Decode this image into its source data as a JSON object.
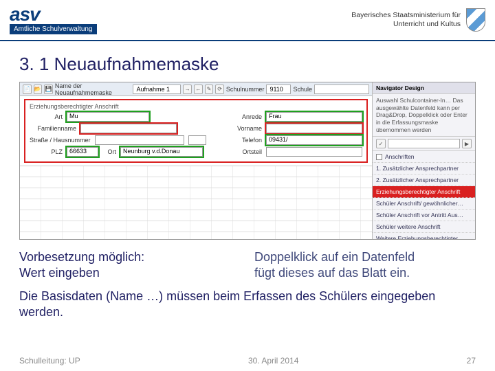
{
  "header": {
    "logo": "asv",
    "logo_sub": "Amtliche Schulverwaltung",
    "ministry_line1": "Bayerisches Staatsministerium für",
    "ministry_line2": "Unterricht und Kultus"
  },
  "slide": {
    "title": "3. 1 Neuaufnahmemaske"
  },
  "toolbar": {
    "name_label": "Name der Neuaufnahmemaske",
    "name_value": "Aufnahme 1",
    "schulnr_label": "Schulnummer",
    "schulnr_value": "9110",
    "schule_label": "Schule"
  },
  "form": {
    "group_label": "Erziehungsberechtigter Anschrift",
    "art_label": "Art",
    "art_value": "Mu",
    "anrede_label": "Anrede",
    "anrede_value": "Frau",
    "familienname_label": "Familienname",
    "vorname_label": "Vorname",
    "strasse_label": "Straße / Hausnummer",
    "telefon_label": "Telefon",
    "telefon_value": "09431/",
    "plz_label": "PLZ",
    "plz_value": "66633",
    "ort_label": "Ort",
    "ort_value": "Neunburg v.d.Donau",
    "ortsteil_label": "Ortsteil"
  },
  "side": {
    "title": "Navigator Design",
    "hint": "Auswahl Schulcontainer-In… Das ausgewählte Datenfeld kann per Drag&Drop, Doppelklick oder Enter in die Erfassungsmaske übernommen werden",
    "search_btn_a": "✓",
    "checkbox_label": "Anschriften",
    "items": [
      {
        "label": "1. Zusätzlicher Ansprechpartner",
        "sel": false
      },
      {
        "label": "2. Zusätzlicher Ansprechpartner",
        "sel": false
      },
      {
        "label": "Erziehungsberechtigter Anschrift",
        "sel": true
      },
      {
        "label": "Schüler Anschrift/ gewöhnlicher…",
        "sel": false
      },
      {
        "label": "Schüler Anschrift vor Antritt Aus…",
        "sel": false
      },
      {
        "label": "Schüler weitere Anschrift",
        "sel": false
      },
      {
        "label": "Weitere Erziehungsberechtigter…",
        "sel": false
      }
    ]
  },
  "captions": {
    "left_l1": "Vorbesetzung möglich:",
    "left_l2": "Wert eingeben",
    "right_l1": "Doppelklick auf ein Datenfeld",
    "right_l2": "fügt dieses auf das Blatt ein."
  },
  "bottom": "Die Basisdaten (Name …) müssen beim Erfassen des Schülers eingegeben werden.",
  "footer": {
    "left": "Schulleitung: UP",
    "center": "30. April 2014",
    "right": "27"
  }
}
